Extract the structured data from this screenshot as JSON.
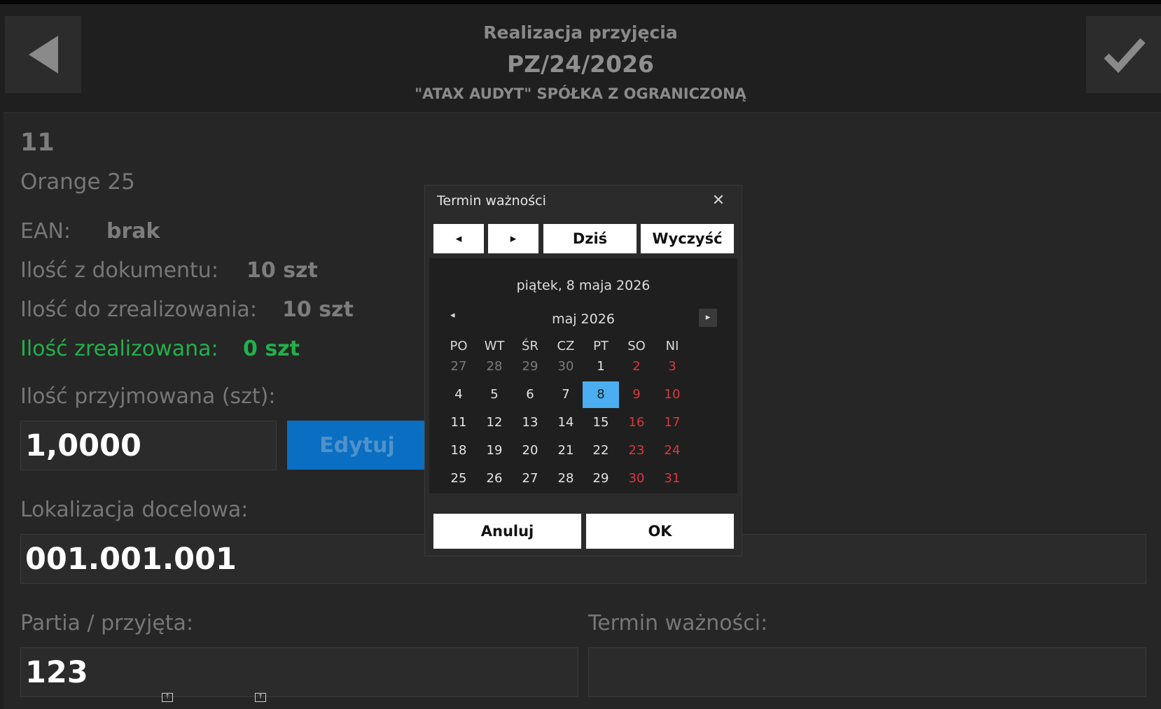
{
  "header": {
    "subtitle": "Realizacja przyjęcia",
    "title": "PZ/24/2026",
    "company": "\"ATAX AUDYT\" SPÓŁKA Z OGRANICZONĄ"
  },
  "item": {
    "lp": "11",
    "name": "Orange 25",
    "ean_label": "EAN:",
    "ean_value": "brak",
    "qty_doc_label": "Ilość z dokumentu:",
    "qty_doc_value": "10 szt",
    "qty_todo_label": "Ilość do zrealizowania:",
    "qty_todo_value": "10 szt",
    "qty_done_label": "Ilość zrealizowana:",
    "qty_done_value": "0 szt"
  },
  "form": {
    "qty_in_label": "Ilość przyjmowana (szt):",
    "qty_in_value": "1,0000",
    "edit_label": "Edytuj",
    "location_label": "Lokalizacja docelowa:",
    "location_value": "001.001.001",
    "batch_label": "Partia / przyjęta:",
    "batch_value": "123",
    "expiry_label": "Termin ważności:",
    "expiry_value": ""
  },
  "dialog": {
    "title": "Termin ważności",
    "nav_prev": "◂",
    "nav_next": "▸",
    "today_label": "Dziś",
    "clear_label": "Wyczyść",
    "selected_date": "piątek, 8 maja 2026",
    "month_label": "maj 2026",
    "weekdays": [
      "PO",
      "WT",
      "ŚR",
      "CZ",
      "PT",
      "SO",
      "NI"
    ],
    "weeks": [
      [
        "27",
        "28",
        "29",
        "30",
        "1",
        "2",
        "3"
      ],
      [
        "4",
        "5",
        "6",
        "7",
        "8",
        "9",
        "10"
      ],
      [
        "11",
        "12",
        "13",
        "14",
        "15",
        "16",
        "17"
      ],
      [
        "18",
        "19",
        "20",
        "21",
        "22",
        "23",
        "24"
      ],
      [
        "25",
        "26",
        "27",
        "28",
        "29",
        "30",
        "31"
      ]
    ],
    "selected_day": "8",
    "cancel_label": "Anuluj",
    "ok_label": "OK"
  },
  "colors": {
    "background": "#1f1f1f",
    "accent_blue": "#0a6ec2",
    "selected_day": "#4aaef0",
    "weekend_red": "#d9383f",
    "done_green": "#22b04a"
  },
  "icons": {
    "back": "back-arrow-icon",
    "confirm": "checkmark-icon",
    "close": "close-icon",
    "calendar_prev": "triangle-left-icon",
    "calendar_next": "triangle-right-icon"
  }
}
